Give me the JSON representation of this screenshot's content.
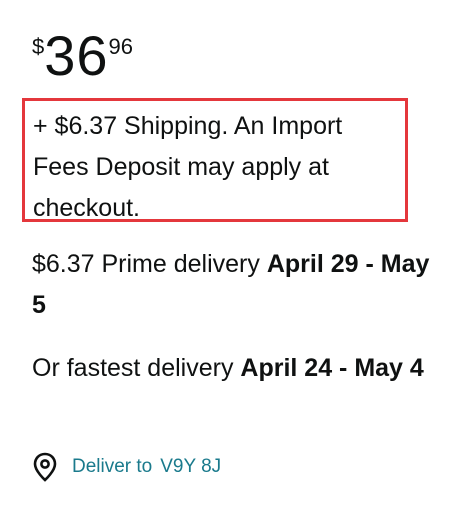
{
  "price": {
    "symbol": "$",
    "whole": "36",
    "fraction": "96"
  },
  "shipping_note": "+ $6.37 Shipping. An Import Fees Deposit may apply at checkout.",
  "prime_delivery": {
    "prefix": "$6.37 Prime delivery ",
    "dates": "April 29 - May 5"
  },
  "fastest_delivery": {
    "prefix": "Or fastest delivery ",
    "dates": "April 24 - May 4"
  },
  "deliver_to": {
    "label": "Deliver to",
    "postal_code": "V9Y 8J",
    "icon": "location-pin-icon"
  },
  "colors": {
    "highlight_border": "#e4373c",
    "link": "#1a7a8c",
    "text": "#0f1111"
  }
}
